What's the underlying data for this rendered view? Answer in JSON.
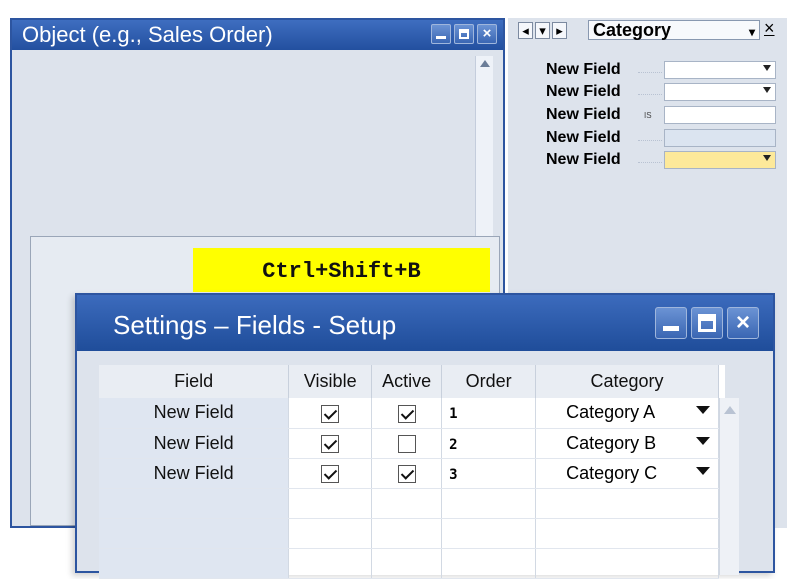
{
  "object_window": {
    "title": "Object (e.g., Sales Order)",
    "close_glyph": "×"
  },
  "shortcut_hint": "Ctrl+Shift+B",
  "category_panel": {
    "nav": [
      "◂",
      "▾",
      "▸"
    ],
    "title": "Category",
    "close_glyph": "×",
    "fields": [
      {
        "label": "New Field",
        "type": "dropdown"
      },
      {
        "label": "New Field",
        "type": "dropdown"
      },
      {
        "label": "New Field",
        "type": "text",
        "marker": "IS"
      },
      {
        "label": "New Field",
        "type": "disabled"
      },
      {
        "label": "New Field",
        "type": "dropdown-highlighted"
      }
    ]
  },
  "settings_window": {
    "title": "Settings – Fields - Setup",
    "close_glyph": "×",
    "columns": [
      "Field",
      "Visible",
      "Active",
      "Order",
      "Category"
    ],
    "rows": [
      {
        "field": "New Field",
        "visible": true,
        "active": true,
        "order": "1",
        "category": "Category A"
      },
      {
        "field": "New Field",
        "visible": true,
        "active": false,
        "order": "2",
        "category": "Category B"
      },
      {
        "field": "New Field",
        "visible": true,
        "active": true,
        "order": "3",
        "category": "Category C"
      }
    ],
    "empty_rows": 3
  },
  "colors": {
    "title_bar": "#2d5aa8",
    "highlight_yellow": "#ffff00",
    "field_highlight": "#fde99a"
  }
}
